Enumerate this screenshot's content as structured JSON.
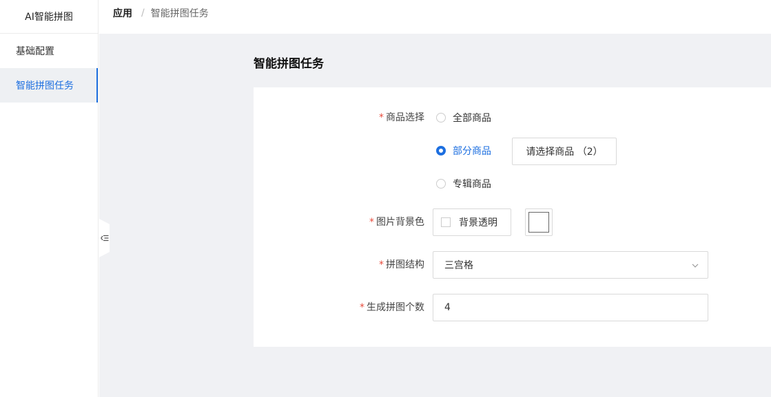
{
  "sidebar": {
    "app_title": "AI智能拼图",
    "items": [
      {
        "label": "基础配置"
      },
      {
        "label": "智能拼图任务"
      }
    ]
  },
  "breadcrumb": {
    "root": "应用",
    "separator": "/",
    "current": "智能拼图任务"
  },
  "page": {
    "title": "智能拼图任务"
  },
  "form": {
    "required_mark": "*",
    "product_selection": {
      "label": "商品选择",
      "options": [
        {
          "label": "全部商品",
          "checked": false
        },
        {
          "label": "部分商品",
          "checked": true
        },
        {
          "label": "专辑商品",
          "checked": false
        }
      ],
      "select_button": "请选择商品 （2）"
    },
    "background_color": {
      "label": "图片背景色",
      "transparent_label": "背景透明",
      "transparent_checked": false,
      "color": "#ffffff"
    },
    "structure": {
      "label": "拼图结构",
      "value": "三宫格"
    },
    "count": {
      "label": "生成拼图个数",
      "value": "4"
    }
  },
  "colors": {
    "accent": "#1d6fe0",
    "required": "#e84b3c",
    "background": "#f0f1f4"
  },
  "icons": {
    "collapse": "collapse-sidebar-icon",
    "chevron": "chevron-down-icon"
  }
}
